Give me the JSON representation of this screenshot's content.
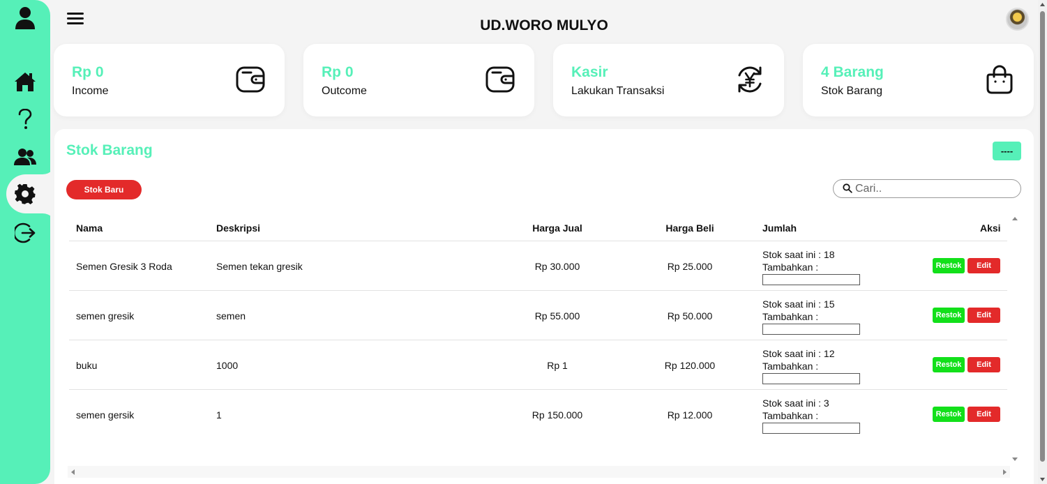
{
  "app": {
    "title": "UD.WORO MULYO"
  },
  "sidebar": {
    "items": [
      {
        "name": "user-icon"
      },
      {
        "name": "home-icon"
      },
      {
        "name": "help-icon"
      },
      {
        "name": "users-icon"
      },
      {
        "name": "gear-icon",
        "active": true
      },
      {
        "name": "logout-icon"
      }
    ],
    "color": "#56f0b8"
  },
  "cards": [
    {
      "value": "Rp 0",
      "label": "Income",
      "icon": "wallet-icon"
    },
    {
      "value": "Rp 0",
      "label": "Outcome",
      "icon": "wallet-icon"
    },
    {
      "value": "Kasir",
      "label": "Lakukan Transaksi",
      "icon": "yen-exchange-icon"
    },
    {
      "value": "4 Barang",
      "label": "Stok Barang",
      "icon": "shopping-bag-icon"
    }
  ],
  "panel": {
    "title": "Stok Barang",
    "dash_label": "----",
    "new_stock_label": "Stok Baru",
    "search_placeholder": "Cari.."
  },
  "table": {
    "headers": [
      "Nama",
      "Deskripsi",
      "Harga Jual",
      "Harga Beli",
      "Jumlah",
      "Aksi"
    ],
    "rows": [
      {
        "nama": "Semen Gresik 3 Roda",
        "deskripsi": "Semen tekan gresik",
        "harga_jual": "Rp 30.000",
        "harga_beli": "Rp 25.000",
        "stok": "Stok saat ini : 18",
        "tambahkan": "Tambahkan :"
      },
      {
        "nama": "semen gresik",
        "deskripsi": "semen",
        "harga_jual": "Rp 55.000",
        "harga_beli": "Rp 50.000",
        "stok": "Stok saat ini : 15",
        "tambahkan": "Tambahkan :"
      },
      {
        "nama": "buku",
        "deskripsi": "1000",
        "harga_jual": "Rp 1",
        "harga_beli": "Rp 120.000",
        "stok": "Stok saat ini : 12",
        "tambahkan": "Tambahkan :"
      },
      {
        "nama": "semen gersik",
        "deskripsi": "1",
        "harga_jual": "Rp 150.000",
        "harga_beli": "Rp 12.000",
        "stok": "Stok saat ini : 3",
        "tambahkan": "Tambahkan :"
      }
    ],
    "restok_label": "Restok",
    "edit_label": "Edit"
  },
  "colors": {
    "accent": "#56f0b8",
    "danger": "#e32a2a",
    "success": "#12e01a"
  }
}
